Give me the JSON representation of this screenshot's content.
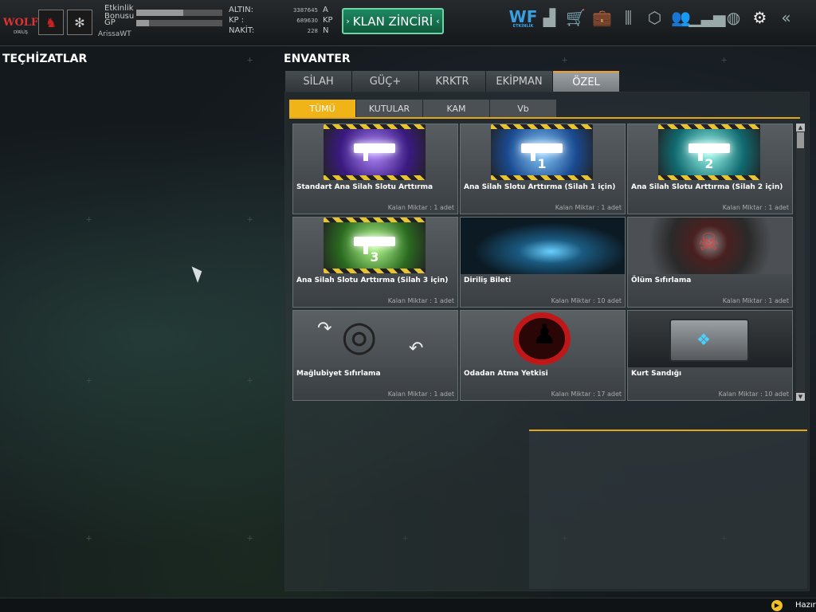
{
  "header": {
    "player_name": "ArissaWT",
    "event_bonus_label": "Etkinlik Bonusu",
    "event_bonus_progress": 0.55,
    "gp_label": "GP",
    "gp_progress": 0.15,
    "resources": [
      {
        "label": "ALTIN:",
        "value": "3387645",
        "unit": "A"
      },
      {
        "label": "KP :",
        "value": "689630",
        "unit": "KP"
      },
      {
        "label": "NAKİT:",
        "value": "228",
        "unit": "N"
      }
    ],
    "clan_chain_button": "KLAN ZİNCİRİ",
    "brand_short": "WF",
    "brand_sub": "ETKİNLİK",
    "logo_text": "WOLF",
    "logo_sub": "DİRİLİŞ"
  },
  "left_panel": {
    "title": "TEÇHİZATLAR"
  },
  "inventory": {
    "title": "ENVANTER",
    "tabs": [
      "SİLAH",
      "GÜÇ+",
      "KRKTR",
      "EKİPMAN",
      "ÖZEL"
    ],
    "active_tab": "ÖZEL",
    "subtabs": [
      "TÜMÜ",
      "KUTULAR",
      "KAM",
      "Vb"
    ],
    "active_subtab": "TÜMÜ",
    "items": [
      {
        "name": "Standart Ana Silah Slotu Arttırma",
        "qty": "Kalan Miktar : 1 adet"
      },
      {
        "name": "Ana Silah Slotu Arttırma (Silah 1 için)",
        "qty": "Kalan Miktar : 1 adet",
        "badge": "1"
      },
      {
        "name": "Ana Silah Slotu Arttırma (Silah 2 için)",
        "qty": "Kalan Miktar : 1 adet",
        "badge": "2"
      },
      {
        "name": "Ana Silah Slotu Arttırma (Silah 3 için)",
        "qty": "Kalan Miktar : 1 adet",
        "badge": "3"
      },
      {
        "name": "Diriliş Bileti",
        "qty": "Kalan Miktar : 10 adet"
      },
      {
        "name": "Ölüm Sıfırlama",
        "qty": "Kalan Miktar : 1 adet"
      },
      {
        "name": "Mağlubiyet  Sıfırlama",
        "qty": "Kalan Miktar : 1 adet"
      },
      {
        "name": "Odadan Atma Yetkisi",
        "qty": "Kalan Miktar : 17 adet"
      },
      {
        "name": "Kurt Sandığı",
        "qty": "Kalan Miktar : 10 adet"
      }
    ]
  },
  "footer": {
    "status": "Hazır"
  },
  "colors": {
    "accent": "#f0b418",
    "clan_green": "#1d8a62",
    "brand_blue": "#3a9ee0"
  }
}
